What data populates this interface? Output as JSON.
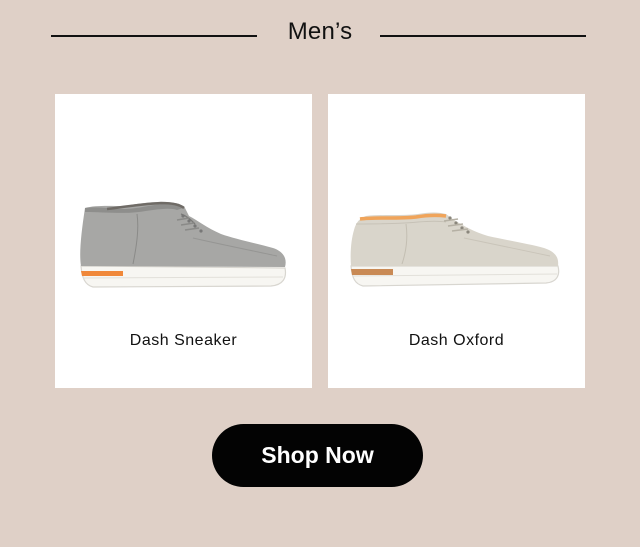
{
  "section": {
    "title": "Men’s"
  },
  "products": [
    {
      "name": "Dash Sneaker",
      "icon": "gray-suede-chukka-sneaker-icon",
      "upper_color": "#9a9a98",
      "accent_color": "#f0883a"
    },
    {
      "name": "Dash Oxford",
      "icon": "beige-lace-up-oxford-icon",
      "upper_color": "#d5d1c6",
      "accent_color": "#c98a55"
    }
  ],
  "cta": {
    "label": "Shop Now"
  },
  "colors": {
    "background": "#dfd0c7",
    "card": "#ffffff",
    "button": "#030303",
    "button_text": "#ffffff"
  }
}
